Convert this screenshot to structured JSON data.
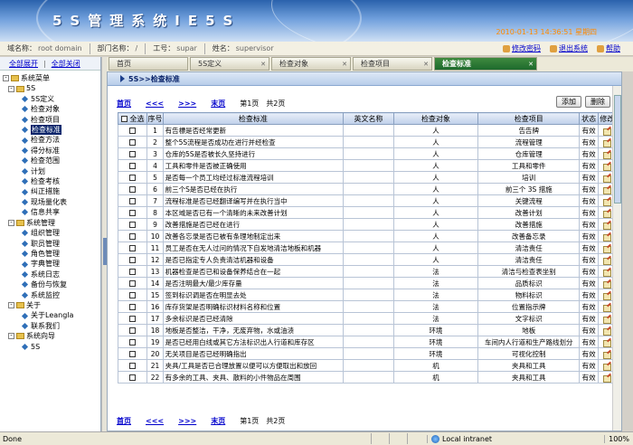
{
  "header": {
    "title": "5S管理系统IE5S",
    "datetime": "2010-01-13 14:36:51 星期四"
  },
  "info": {
    "domain_label": "域名称：",
    "domain_value": "root domain",
    "dept_label": "部门名称：",
    "dept_value": "/",
    "jobno_label": "工号：",
    "jobno_value": "supar",
    "name_label": "姓名：",
    "name_value": "supervisor",
    "links": [
      "修改密码",
      "退出系统",
      "帮助"
    ]
  },
  "sidebar": {
    "expand_all": "全部展开",
    "collapse_all": "全部关闭",
    "root": "系统菜单",
    "groups": [
      {
        "label": "5S",
        "items": [
          "5S定义",
          "检查对象",
          "检查项目",
          "检查标准",
          "检查方法",
          "得分标准",
          "检查范围",
          "计划",
          "检查考核",
          "纠正措施",
          "现场量化表",
          "信息共享"
        ]
      },
      {
        "label": "系统管理",
        "items": [
          "组织管理",
          "职员管理",
          "角色管理",
          "字典管理",
          "系统日志",
          "备份与恢复",
          "系统监控"
        ]
      },
      {
        "label": "关于",
        "items": [
          "关于Leangla",
          "联系我们"
        ]
      },
      {
        "label": "系统向导",
        "items": [
          "5S"
        ]
      }
    ],
    "selected": "检查标准"
  },
  "tabs": [
    "首页",
    "5S定义",
    "检查对象",
    "检查项目",
    "检查标准"
  ],
  "active_tab": "检查标准",
  "crumb": "5S>>检查标准",
  "pager": {
    "first": "首页",
    "prev": "<<<",
    "next": ">>>",
    "last": "末页",
    "page": "第1页",
    "total": "共2页"
  },
  "actions": {
    "add": "添加",
    "delete": "删除"
  },
  "table": {
    "headers": [
      "全选",
      "序号",
      "检查标准",
      "英文名称",
      "检查对象",
      "检查项目",
      "状态",
      "修改"
    ],
    "rows": [
      [
        "1",
        "有告標是否经常更新",
        "",
        "人",
        "告告牌",
        "有效"
      ],
      [
        "2",
        "整个5S流程是否成功在进行并经检查",
        "",
        "人",
        "流程管理",
        "有效"
      ],
      [
        "3",
        "仓库的5S是否被长久坚持进行",
        "",
        "人",
        "仓库管理",
        "有效"
      ],
      [
        "4",
        "工具和零件是否被正确使用",
        "",
        "人",
        "工具和零件",
        "有效"
      ],
      [
        "5",
        "是否每一个员工均经过标准流程培训",
        "",
        "人",
        "培训",
        "有效"
      ],
      [
        "6",
        "前三个S是否已经在执行",
        "",
        "人",
        "前三个 3S 措施",
        "有效"
      ],
      [
        "7",
        "流程标准是否已经翻译编写并在执行当中",
        "",
        "人",
        "关键流程",
        "有效"
      ],
      [
        "8",
        "本区域是否已有一个清晰的未来改善计划",
        "",
        "人",
        "改善计划",
        "有效"
      ],
      [
        "9",
        "改善措施是否已经在进行",
        "",
        "人",
        "改善措施",
        "有效"
      ],
      [
        "10",
        "改善各忘录是否已被有条理地制定出来",
        "",
        "人",
        "改善备忘录",
        "有效"
      ],
      [
        "11",
        "员工是否在无人过问的情况下自发地清洁地板和机器",
        "",
        "人",
        "清洁责任",
        "有效"
      ],
      [
        "12",
        "是否已指定专人负责清洁机器和设备",
        "",
        "人",
        "清洁责任",
        "有效"
      ],
      [
        "13",
        "机器检查是否已和设备保养结合在一起",
        "",
        "法",
        "清洁与检查表坐别",
        "有效"
      ],
      [
        "14",
        "是否注明最大/最少库存量",
        "",
        "法",
        "品质标识",
        "有效"
      ],
      [
        "15",
        "签到标识调是否在明显去处",
        "",
        "法",
        "物料标识",
        "有效"
      ],
      [
        "16",
        "库存货架是否明确标识材料名称和位置",
        "",
        "法",
        "位置指示牌",
        "有效"
      ],
      [
        "17",
        "多余标识是否已经清除",
        "",
        "法",
        "文字标识",
        "有效"
      ],
      [
        "18",
        "地板是否整洁，干净，无废弃物，水或油渍",
        "",
        "环境",
        "地板",
        "有效"
      ],
      [
        "19",
        "是否已经用白线或其它方法标识出人行道和库存区",
        "",
        "环境",
        "车间内人行道和生产路线划分",
        "有效"
      ],
      [
        "20",
        "无关项目是否已经明确指出",
        "",
        "环境",
        "可视化控制",
        "有效"
      ],
      [
        "21",
        "夹具/工具是否已合理放置以便可以方便取出和放回",
        "",
        "机",
        "夹具和工具",
        "有效"
      ],
      [
        "22",
        "有多余的工具、夹具、散料的小件物品在周围",
        "",
        "机",
        "夹具和工具",
        "有效"
      ]
    ]
  },
  "status": {
    "text": "Done",
    "zone": "Local intranet",
    "zoom": "100%"
  }
}
